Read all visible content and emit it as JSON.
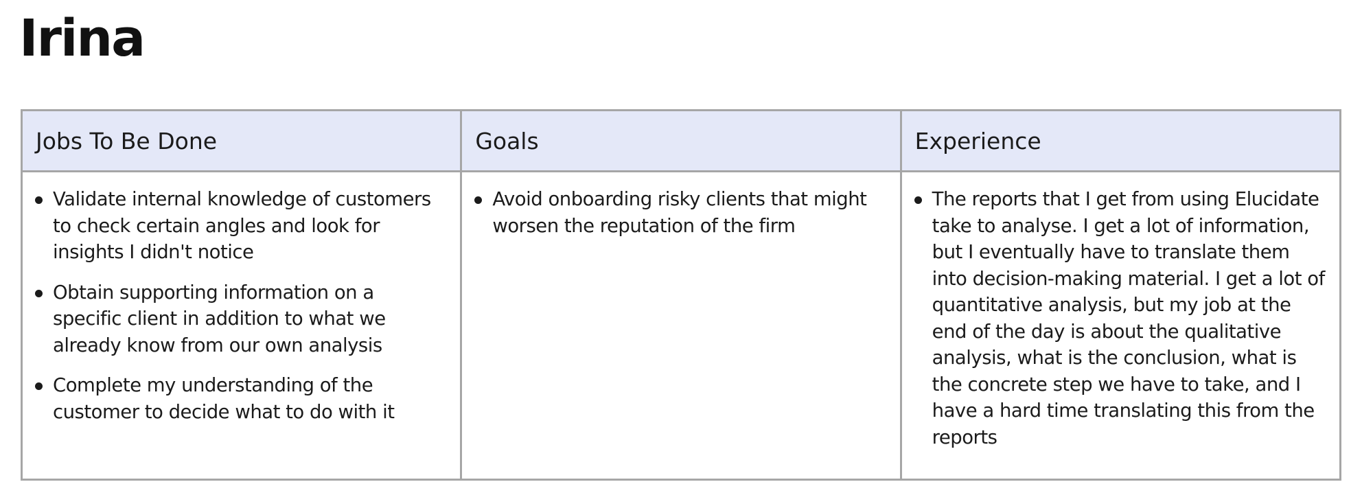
{
  "persona": {
    "name": "Irina"
  },
  "table": {
    "headers": [
      "Jobs To Be Done",
      "Goals",
      "Experience"
    ],
    "columns": [
      {
        "items": [
          "Validate internal knowledge of customers to check certain angles and look for insights I didn't notice",
          "Obtain supporting information on a specific client in addition to what we already know from our own analysis",
          "Complete my understanding of the customer to decide what to do with it"
        ]
      },
      {
        "items": [
          "Avoid onboarding risky clients that might worsen the reputation of the firm"
        ]
      },
      {
        "items": [
          "The reports that I get from using Elucidate take to analyse. I get a lot of information, but I eventually have to translate them into decision-making material. I get a lot of quantitative analysis, but my job at the end of the day is about the qualitative analysis, what is the conclusion, what is the concrete step we have to take, and I have a hard time translating this from the reports"
        ]
      }
    ]
  },
  "colors": {
    "header_background": "#e4e8f8",
    "border": "#a6a6a6",
    "text": "#1b1b1b"
  }
}
